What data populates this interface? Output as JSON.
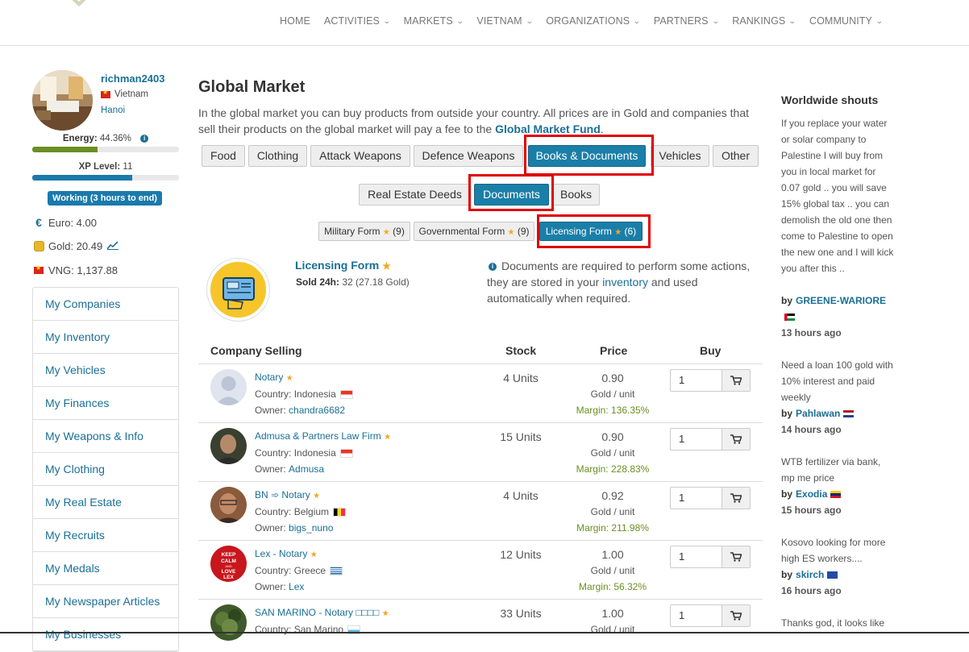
{
  "nav": {
    "items": [
      {
        "label": "HOME",
        "caret": false
      },
      {
        "label": "ACTIVITIES",
        "caret": true
      },
      {
        "label": "MARKETS",
        "caret": true
      },
      {
        "label": "VIETNAM",
        "caret": true
      },
      {
        "label": "ORGANIZATIONS",
        "caret": true
      },
      {
        "label": "PARTNERS",
        "caret": true
      },
      {
        "label": "RANKINGS",
        "caret": true
      },
      {
        "label": "COMMUNITY",
        "caret": true
      }
    ]
  },
  "user": {
    "name": "richman2403",
    "country": "Vietnam",
    "city": "Hanoi",
    "energy_label": "Energy:",
    "energy_value": "44.36%",
    "energy_level": 0.4436,
    "xp_label": "XP Level:",
    "xp_value": "11",
    "xp_progress": 0.68,
    "working": "Working (3 hours to end)",
    "euro": "Euro: 4.00",
    "gold": "Gold: 20.49",
    "vng": "VNG: 1,137.88"
  },
  "sidebar": {
    "items": [
      "My Companies",
      "My Inventory",
      "My Vehicles",
      "My Finances",
      "My Weapons & Info",
      "My Clothing",
      "My Real Estate",
      "My Recruits",
      "My Medals",
      "My Newspaper Articles",
      "My Businesses"
    ]
  },
  "main": {
    "title": "Global Market",
    "intro": "In the global market you can buy products from outside your country. All prices are in Gold and companies that sell their products on the global market will pay a fee to the ",
    "intro_link": "Global Market Fund",
    "intro_end": ".",
    "categories": [
      "Food",
      "Clothing",
      "Attack Weapons",
      "Defence Weapons",
      "Books & Documents",
      "Vehicles",
      "Other"
    ],
    "subcategories": [
      "Real Estate Deeds",
      "Documents",
      "Books"
    ],
    "forms": [
      {
        "label": "Military Form",
        "count": "(9)"
      },
      {
        "label": "Governmental Form",
        "count": "(9)"
      },
      {
        "label": "Licensing Form",
        "count": "(6)"
      }
    ],
    "product": {
      "name": "Licensing Form",
      "sold_label": "Sold 24h:",
      "sold_value": "32 (27.18 Gold)"
    },
    "doc_info_pre": "Documents are required to perform some actions, they are stored in your ",
    "doc_info_link": "inventory",
    "doc_info_post": " and used automatically when required.",
    "headers": {
      "company": "Company Selling",
      "stock": "Stock",
      "price": "Price",
      "buy": "Buy"
    },
    "rows": [
      {
        "name": "Notary",
        "country_label": "Country:",
        "country": "Indonesia",
        "owner_label": "Owner:",
        "owner": "chandra6682",
        "stock": "4 Units",
        "price": "0.90",
        "unit": "Gold / unit",
        "margin": "Margin: 136.35%",
        "qty": "1"
      },
      {
        "name": "Admusa & Partners Law Firm",
        "country_label": "Country:",
        "country": "Indonesia",
        "owner_label": "Owner:",
        "owner": "Admusa",
        "stock": "15 Units",
        "price": "0.90",
        "unit": "Gold / unit",
        "margin": "Margin: 228.83%",
        "qty": "1"
      },
      {
        "name": "BN ➾ Notary",
        "country_label": "Country:",
        "country": "Belgium",
        "owner_label": "Owner:",
        "owner": "bigs_nuno",
        "stock": "4 Units",
        "price": "0.92",
        "unit": "Gold / unit",
        "margin": "Margin: 211.98%",
        "qty": "1"
      },
      {
        "name": "Lex - Notary",
        "country_label": "Country:",
        "country": "Greece",
        "owner_label": "Owner:",
        "owner": "Lex",
        "stock": "12 Units",
        "price": "1.00",
        "unit": "Gold / unit",
        "margin": "Margin: 56.32%",
        "qty": "1"
      },
      {
        "name": "SAN MARINO - Notary □□□□",
        "country_label": "Country:",
        "country": "San Marino",
        "owner_label": "",
        "owner": "",
        "stock": "33 Units",
        "price": "1.00",
        "unit": "Gold / unit",
        "margin": "",
        "qty": "1"
      }
    ]
  },
  "shouts": {
    "title": "Worldwide shouts",
    "by_label": "by",
    "items": [
      {
        "text": "If you replace your water or solar company to Palestine I will buy from you in local market for 0.07 gold .. you will save 15% global tax .. you can demolish the old one then come to Palestine to open the new one and I will kick you after this ..",
        "author": "GREENE-WARIORE",
        "time": "13 hours ago"
      },
      {
        "text": "Need a loan 100 gold with 10% interest and paid weekly",
        "author": "Pahlawan",
        "time": "14 hours ago"
      },
      {
        "text": "WTB fertilizer via bank, mp me price",
        "author": "Exodia",
        "time": "15 hours ago"
      },
      {
        "text": "Kosovo looking for more high ES workers....",
        "author": "skirch",
        "time": "16 hours ago"
      },
      {
        "text": "Thanks god, it looks like",
        "author": "",
        "time": ""
      }
    ]
  },
  "colors": {
    "accent": "#1a7fa8",
    "link": "#1a6f95",
    "energy": "#6b8e23",
    "highlight": "#e00000",
    "margin": "#6a8f1f"
  }
}
